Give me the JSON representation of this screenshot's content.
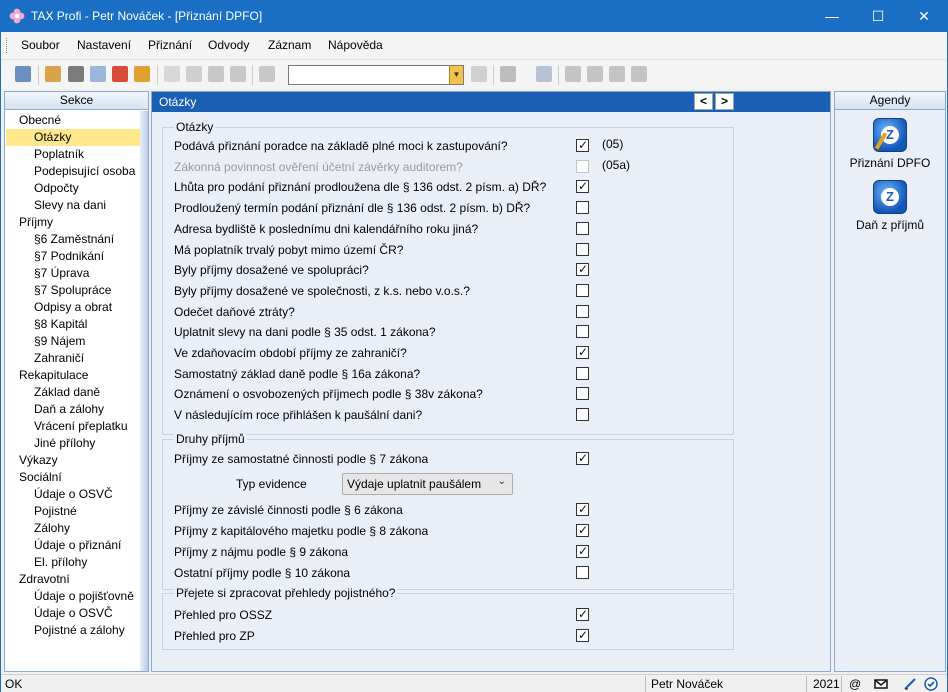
{
  "window": {
    "title": "TAX Profi - Petr Nováček - [Přiznání DPFO]",
    "controls": {
      "minimize": "—",
      "maximize": "☐",
      "close": "✕"
    }
  },
  "menu": [
    "Soubor",
    "Nastavení",
    "Přiznání",
    "Odvody",
    "Záznam",
    "Nápověda"
  ],
  "toolbar": {
    "icons": [
      "pin-icon",
      "export-icon",
      "print-icon",
      "preview-icon",
      "pdf-icon",
      "pdf-sign-icon",
      "new-icon",
      "check-icon",
      "save-icon",
      "save-all-icon",
      "copy-icon",
      "filter-icon",
      "folder-icon",
      "calendar-icon",
      "message-icon",
      "list-icon",
      "note-icon",
      "help-arrow-icon"
    ],
    "search_value": ""
  },
  "left_panel": {
    "header": "Sekce",
    "items": [
      {
        "label": "Obecné",
        "level": 0
      },
      {
        "label": "Otázky",
        "level": 1,
        "selected": true
      },
      {
        "label": "Poplatník",
        "level": 1
      },
      {
        "label": "Podepisující osoba",
        "level": 1
      },
      {
        "label": "Odpočty",
        "level": 1
      },
      {
        "label": "Slevy na dani",
        "level": 1
      },
      {
        "label": "Příjmy",
        "level": 0
      },
      {
        "label": "§6 Zaměstnání",
        "level": 1
      },
      {
        "label": "§7 Podnikání",
        "level": 1
      },
      {
        "label": "§7 Úprava",
        "level": 1
      },
      {
        "label": "§7 Spolupráce",
        "level": 1
      },
      {
        "label": "Odpisy a obrat",
        "level": 1
      },
      {
        "label": "§8 Kapitál",
        "level": 1
      },
      {
        "label": "§9 Nájem",
        "level": 1
      },
      {
        "label": "Zahraničí",
        "level": 1
      },
      {
        "label": "Rekapitulace",
        "level": 0
      },
      {
        "label": "Základ daně",
        "level": 1
      },
      {
        "label": "Daň a zálohy",
        "level": 1
      },
      {
        "label": "Vrácení přeplatku",
        "level": 1
      },
      {
        "label": "Jiné přílohy",
        "level": 1
      },
      {
        "label": "Výkazy",
        "level": 0
      },
      {
        "label": "Sociální",
        "level": 0
      },
      {
        "label": "Údaje o OSVČ",
        "level": 1
      },
      {
        "label": "Pojistné",
        "level": 1
      },
      {
        "label": "Zálohy",
        "level": 1
      },
      {
        "label": "Údaje o přiznání",
        "level": 1
      },
      {
        "label": "El. přílohy",
        "level": 1
      },
      {
        "label": "Zdravotní",
        "level": 0
      },
      {
        "label": "Údaje o pojišťovně",
        "level": 1
      },
      {
        "label": "Údaje o OSVČ",
        "level": 1
      },
      {
        "label": "Pojistné a zálohy",
        "level": 1
      }
    ]
  },
  "main": {
    "header": "Otázky",
    "prev": "<",
    "next": ">",
    "groups": [
      {
        "legend": "Otázky",
        "rows": [
          {
            "label": "Podává přiznání poradce na základě plné moci k zastupování?",
            "checked": true,
            "code": "(05)"
          },
          {
            "label": "Zákonná povinnost ověření účetní závěrky auditorem?",
            "checked": false,
            "disabled": true,
            "code": "(05a)"
          },
          {
            "label": "Lhůta pro podání přiznání prodloužena dle § 136 odst. 2 písm. a) DŘ?",
            "checked": true
          },
          {
            "label": "Prodloužený termín podání přiznání dle § 136 odst. 2 písm. b) DŘ?",
            "checked": false
          },
          {
            "label": "Adresa bydliště k poslednímu dni kalendářního roku jiná?",
            "checked": false
          },
          {
            "label": "Má poplatník trvalý pobyt mimo území ČR?",
            "checked": false
          },
          {
            "label": "Byly příjmy dosažené ve spolupráci?",
            "checked": true
          },
          {
            "label": "Byly příjmy dosažené ve společnosti, z k.s. nebo v.o.s.?",
            "checked": false
          },
          {
            "label": "Odečet daňové ztráty?",
            "checked": false
          },
          {
            "label": "Uplatnit slevy na dani podle § 35 odst. 1 zákona?",
            "checked": false
          },
          {
            "label": "Ve zdaňovacím období příjmy ze zahraničí?",
            "checked": true
          },
          {
            "label": "Samostatný základ daně podle § 16a zákona?",
            "checked": false
          },
          {
            "label": "Oznámení o osvobozených příjmech podle § 38v zákona?",
            "checked": false
          },
          {
            "label": "V následujícím roce přihlášen k paušální dani?",
            "checked": false
          }
        ]
      },
      {
        "legend": "Druhy příjmů",
        "rows": [
          {
            "label": "Příjmy ze samostatné činnosti podle § 7 zákona",
            "checked": true
          },
          {
            "label": "Příjmy ze závislé činnosti podle § 6 zákona",
            "checked": true
          },
          {
            "label": "Příjmy z kapitálového majetku podle § 8 zákona",
            "checked": true
          },
          {
            "label": "Příjmy z nájmu podle § 9 zákona",
            "checked": true
          },
          {
            "label": "Ostatní příjmy podle § 10 zákona",
            "checked": false
          }
        ],
        "evidence": {
          "label": "Typ evidence",
          "value": "Výdaje uplatnit paušálem"
        }
      },
      {
        "legend": "Přejete si zpracovat přehledy pojistného?",
        "rows": [
          {
            "label": "Přehled pro OSSZ",
            "checked": true
          },
          {
            "label": "Přehled pro ZP",
            "checked": true
          }
        ]
      }
    ]
  },
  "right_panel": {
    "header": "Agendy",
    "items": [
      {
        "label": "Přiznání DPFO",
        "icon": "dpfo-agenda-icon"
      },
      {
        "label": "Daň z příjmů",
        "icon": "income-tax-agenda-icon"
      }
    ]
  },
  "status": {
    "left": "OK",
    "user": "Petr Nováček",
    "year": "2021",
    "at": "@"
  },
  "colors": {
    "titlebar": "#1a6fc4",
    "section_header": "#1a5fb4",
    "selection": "#ffe88c",
    "panel_bg": "#eaeff7"
  }
}
